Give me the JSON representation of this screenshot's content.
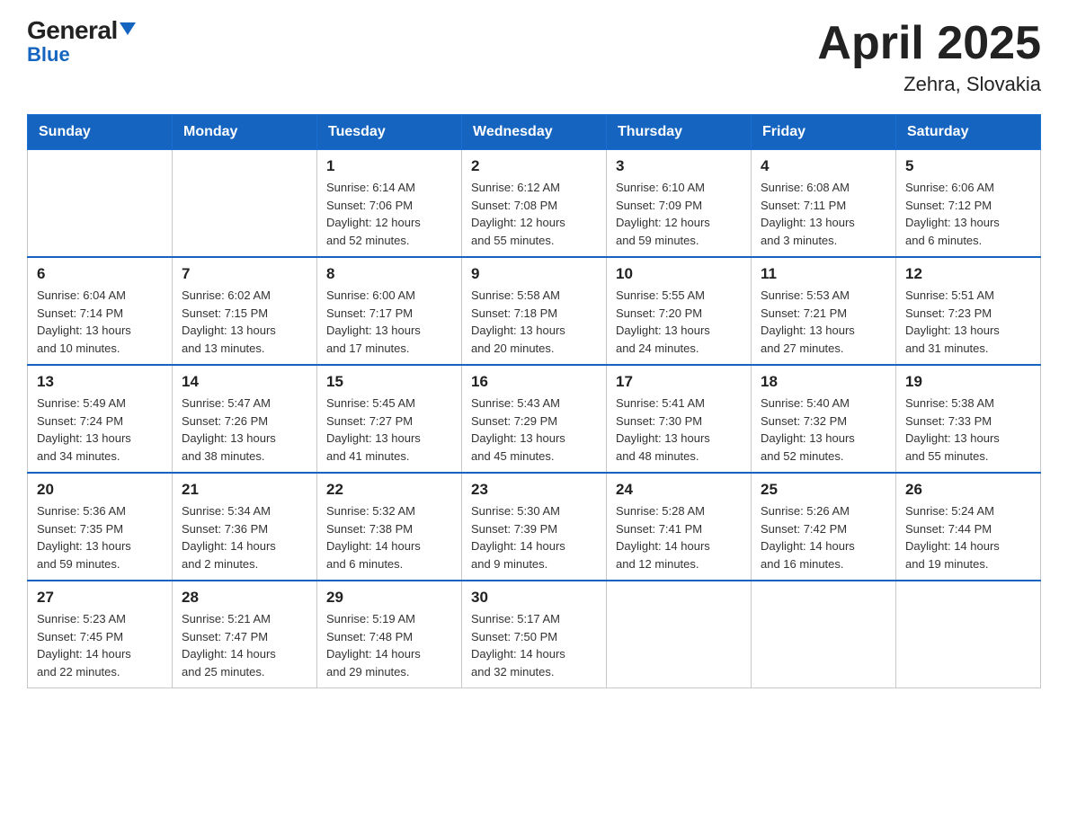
{
  "header": {
    "logo_general": "General",
    "logo_blue": "Blue",
    "month_year": "April 2025",
    "location": "Zehra, Slovakia"
  },
  "weekdays": [
    "Sunday",
    "Monday",
    "Tuesday",
    "Wednesday",
    "Thursday",
    "Friday",
    "Saturday"
  ],
  "weeks": [
    [
      {
        "day": "",
        "info": ""
      },
      {
        "day": "",
        "info": ""
      },
      {
        "day": "1",
        "info": "Sunrise: 6:14 AM\nSunset: 7:06 PM\nDaylight: 12 hours\nand 52 minutes."
      },
      {
        "day": "2",
        "info": "Sunrise: 6:12 AM\nSunset: 7:08 PM\nDaylight: 12 hours\nand 55 minutes."
      },
      {
        "day": "3",
        "info": "Sunrise: 6:10 AM\nSunset: 7:09 PM\nDaylight: 12 hours\nand 59 minutes."
      },
      {
        "day": "4",
        "info": "Sunrise: 6:08 AM\nSunset: 7:11 PM\nDaylight: 13 hours\nand 3 minutes."
      },
      {
        "day": "5",
        "info": "Sunrise: 6:06 AM\nSunset: 7:12 PM\nDaylight: 13 hours\nand 6 minutes."
      }
    ],
    [
      {
        "day": "6",
        "info": "Sunrise: 6:04 AM\nSunset: 7:14 PM\nDaylight: 13 hours\nand 10 minutes."
      },
      {
        "day": "7",
        "info": "Sunrise: 6:02 AM\nSunset: 7:15 PM\nDaylight: 13 hours\nand 13 minutes."
      },
      {
        "day": "8",
        "info": "Sunrise: 6:00 AM\nSunset: 7:17 PM\nDaylight: 13 hours\nand 17 minutes."
      },
      {
        "day": "9",
        "info": "Sunrise: 5:58 AM\nSunset: 7:18 PM\nDaylight: 13 hours\nand 20 minutes."
      },
      {
        "day": "10",
        "info": "Sunrise: 5:55 AM\nSunset: 7:20 PM\nDaylight: 13 hours\nand 24 minutes."
      },
      {
        "day": "11",
        "info": "Sunrise: 5:53 AM\nSunset: 7:21 PM\nDaylight: 13 hours\nand 27 minutes."
      },
      {
        "day": "12",
        "info": "Sunrise: 5:51 AM\nSunset: 7:23 PM\nDaylight: 13 hours\nand 31 minutes."
      }
    ],
    [
      {
        "day": "13",
        "info": "Sunrise: 5:49 AM\nSunset: 7:24 PM\nDaylight: 13 hours\nand 34 minutes."
      },
      {
        "day": "14",
        "info": "Sunrise: 5:47 AM\nSunset: 7:26 PM\nDaylight: 13 hours\nand 38 minutes."
      },
      {
        "day": "15",
        "info": "Sunrise: 5:45 AM\nSunset: 7:27 PM\nDaylight: 13 hours\nand 41 minutes."
      },
      {
        "day": "16",
        "info": "Sunrise: 5:43 AM\nSunset: 7:29 PM\nDaylight: 13 hours\nand 45 minutes."
      },
      {
        "day": "17",
        "info": "Sunrise: 5:41 AM\nSunset: 7:30 PM\nDaylight: 13 hours\nand 48 minutes."
      },
      {
        "day": "18",
        "info": "Sunrise: 5:40 AM\nSunset: 7:32 PM\nDaylight: 13 hours\nand 52 minutes."
      },
      {
        "day": "19",
        "info": "Sunrise: 5:38 AM\nSunset: 7:33 PM\nDaylight: 13 hours\nand 55 minutes."
      }
    ],
    [
      {
        "day": "20",
        "info": "Sunrise: 5:36 AM\nSunset: 7:35 PM\nDaylight: 13 hours\nand 59 minutes."
      },
      {
        "day": "21",
        "info": "Sunrise: 5:34 AM\nSunset: 7:36 PM\nDaylight: 14 hours\nand 2 minutes."
      },
      {
        "day": "22",
        "info": "Sunrise: 5:32 AM\nSunset: 7:38 PM\nDaylight: 14 hours\nand 6 minutes."
      },
      {
        "day": "23",
        "info": "Sunrise: 5:30 AM\nSunset: 7:39 PM\nDaylight: 14 hours\nand 9 minutes."
      },
      {
        "day": "24",
        "info": "Sunrise: 5:28 AM\nSunset: 7:41 PM\nDaylight: 14 hours\nand 12 minutes."
      },
      {
        "day": "25",
        "info": "Sunrise: 5:26 AM\nSunset: 7:42 PM\nDaylight: 14 hours\nand 16 minutes."
      },
      {
        "day": "26",
        "info": "Sunrise: 5:24 AM\nSunset: 7:44 PM\nDaylight: 14 hours\nand 19 minutes."
      }
    ],
    [
      {
        "day": "27",
        "info": "Sunrise: 5:23 AM\nSunset: 7:45 PM\nDaylight: 14 hours\nand 22 minutes."
      },
      {
        "day": "28",
        "info": "Sunrise: 5:21 AM\nSunset: 7:47 PM\nDaylight: 14 hours\nand 25 minutes."
      },
      {
        "day": "29",
        "info": "Sunrise: 5:19 AM\nSunset: 7:48 PM\nDaylight: 14 hours\nand 29 minutes."
      },
      {
        "day": "30",
        "info": "Sunrise: 5:17 AM\nSunset: 7:50 PM\nDaylight: 14 hours\nand 32 minutes."
      },
      {
        "day": "",
        "info": ""
      },
      {
        "day": "",
        "info": ""
      },
      {
        "day": "",
        "info": ""
      }
    ]
  ]
}
